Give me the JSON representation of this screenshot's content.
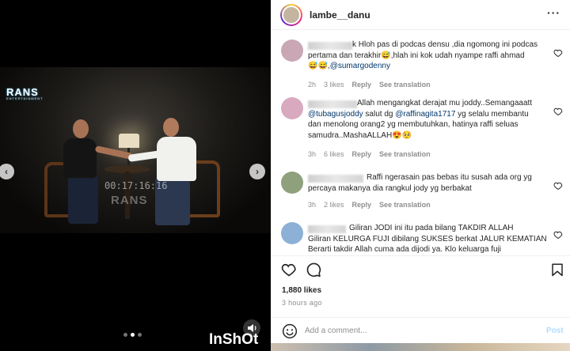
{
  "media": {
    "brand_logo": "RANS",
    "brand_logo_sub": "ENTERTAINMENT",
    "timecode": "00:17:16:16",
    "watermark": "RANS",
    "nav_prev": "‹",
    "nav_next": "›",
    "carousel_dots": 3,
    "carousel_active": 2,
    "editor_watermark": "InShOt"
  },
  "post": {
    "username": "lambe__danu",
    "options_label": "···",
    "likes": "1,880 likes",
    "time_ago": "3 hours ago"
  },
  "comments": [
    {
      "text_lines": [
        "k Hloh pas di podcas densu ,dia ngomong ini podcas",
        "pertama dan terakhir😅,hlah ini kok udah nyampe raffi ahmad",
        "😅😅,"
      ],
      "mention": "@sumargodenny",
      "time": "2h",
      "likes": "3 likes",
      "reply": "Reply",
      "translate": "See translation",
      "avatar_color": "#c9a7b4"
    },
    {
      "text_lines": [
        "Allah mengangkat derajat mu joddy..Semangaaatt",
        " salut dg ",
        " yg selalu membantu",
        "dan menolong orang2 yg membutuhkan, hatinya raffi seluas",
        "samudra..MashaALLAH😍🥺"
      ],
      "mentions": [
        "@tubagusjoddy",
        "@raffinagita1717"
      ],
      "time": "3h",
      "likes": "6 likes",
      "reply": "Reply",
      "translate": "See translation",
      "avatar_color": "#d8a9bf"
    },
    {
      "text_lines": [
        "Raffi ngerasain pas bebas itu susah ada org yg",
        "percaya makanya dia rangkul jody yg berbakat"
      ],
      "time": "3h",
      "likes": "2 likes",
      "reply": "Reply",
      "translate": "See translation",
      "avatar_color": "#8fa07c"
    },
    {
      "text_lines": [
        "Giliran JODI ini itu pada bilang TAKDIR ALLAH",
        "Giliran KELURGA FUJI dibilang SUKSES berkat JALUR KEMATIAN",
        "Berarti takdir Allah cuma ada dijodi ya. Klo keluarga fuji"
      ],
      "avatar_color": "#8cb0d6"
    }
  ],
  "add_comment": {
    "placeholder": "Add a comment...",
    "post_label": "Post"
  },
  "icons": {
    "like": "heart-icon",
    "comment": "comment-bubble-icon",
    "save": "bookmark-icon",
    "emoji": "smiley-icon",
    "mute": "speaker-icon"
  },
  "colors": {
    "mention": "#00376b",
    "meta": "#8e8e8e",
    "post_disabled": "#b3dbff"
  }
}
